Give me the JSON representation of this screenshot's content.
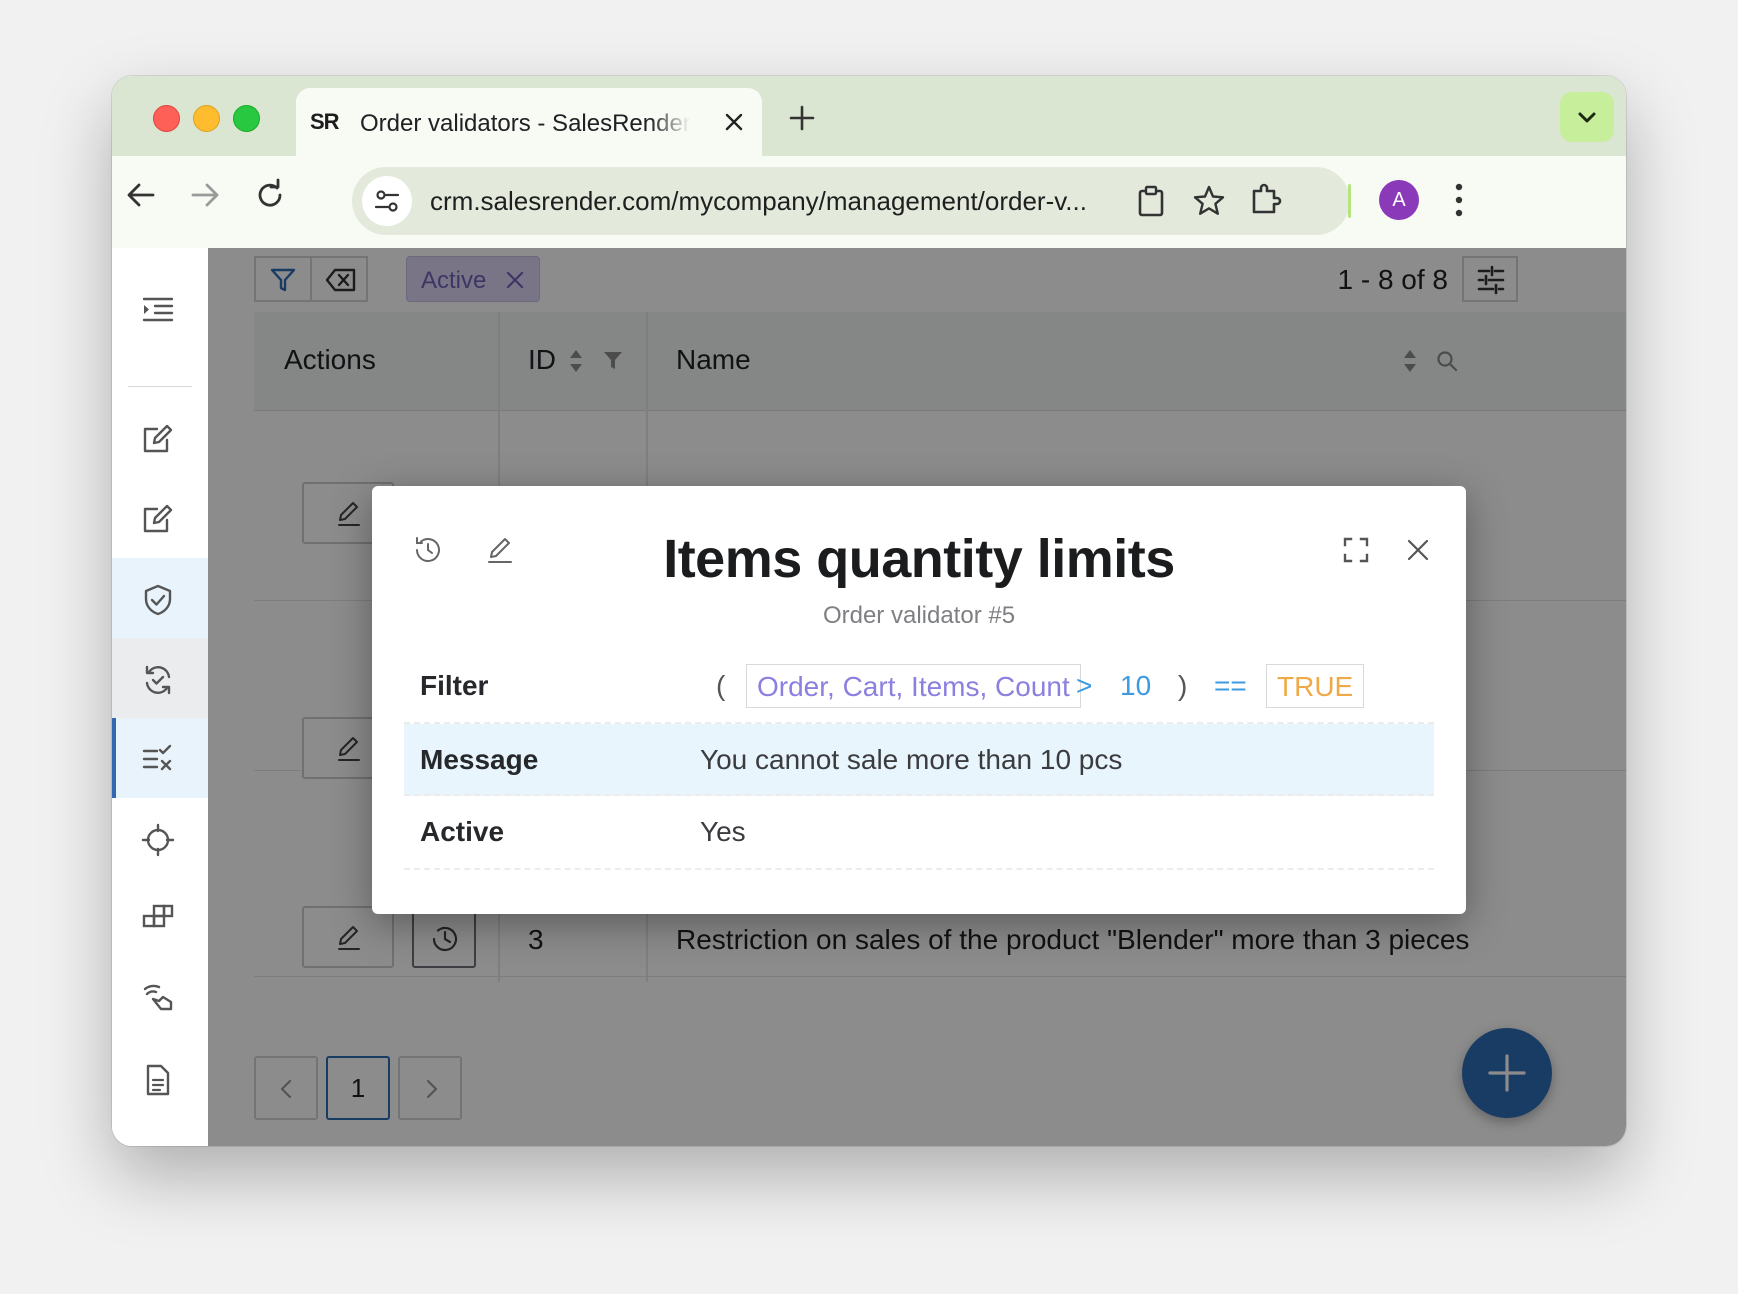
{
  "browser": {
    "tab_title": "Order validators - SalesRender",
    "favicon_text": "SR",
    "url": "crm.salesrender.com/mycompany/management/order-v...",
    "profile_initial": "A"
  },
  "sidebar": {
    "items": [
      {
        "icon": "indent-list-icon"
      },
      {
        "icon": "edit-note-icon"
      },
      {
        "icon": "edit-note-icon"
      },
      {
        "icon": "shield-check-icon"
      },
      {
        "icon": "sync-check-icon"
      },
      {
        "icon": "checklist-icon"
      },
      {
        "icon": "crosshair-icon"
      },
      {
        "icon": "blocks-icon"
      },
      {
        "icon": "signal-hand-icon"
      },
      {
        "icon": "document-icon"
      }
    ]
  },
  "toolbar": {
    "active_filter_chip": "Active",
    "pager_info": "1 - 8 of 8"
  },
  "table": {
    "headers": {
      "actions": "Actions",
      "id": "ID",
      "name": "Name"
    },
    "rows": [
      {
        "id": "",
        "name": ""
      },
      {
        "id": "",
        "name": ""
      },
      {
        "id": "3",
        "name": "Restriction on sales of the product \"Blender\" more than 3 pieces"
      }
    ]
  },
  "pagination": {
    "current_page": "1"
  },
  "modal": {
    "title": "Items quantity limits",
    "subtitle": "Order validator #5",
    "filter": {
      "label": "Filter",
      "open_paren": "(",
      "field": "Order, Cart, Items, Count",
      "operator": ">",
      "value": "10",
      "close_paren": ")",
      "comparator": "==",
      "result": "TRUE"
    },
    "message": {
      "label": "Message",
      "value": "You cannot sale more than 10 pcs"
    },
    "active": {
      "label": "Active",
      "value": "Yes"
    }
  },
  "colors": {
    "accent": "#2f6db8",
    "filter_field": "#8b7fe0",
    "filter_operator": "#3c9ae0",
    "filter_true": "#efaa47",
    "highlight_row": "#e9f5fc",
    "chip_bg": "#dcd6f5"
  }
}
